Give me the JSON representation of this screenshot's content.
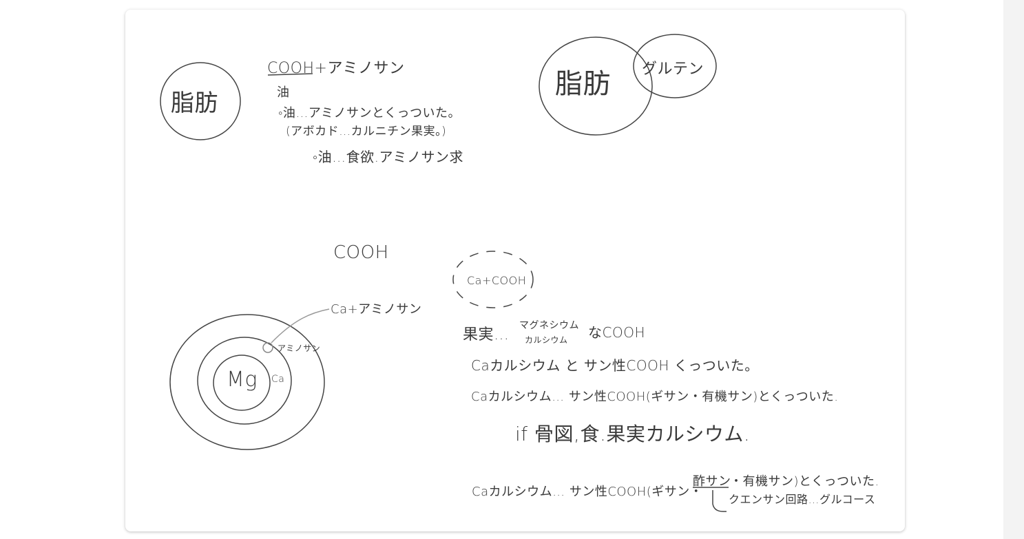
{
  "note": {
    "top_left": {
      "circle_label": "脂肪",
      "formula": "COOH+アミノサン",
      "oil": "油",
      "line1": "◦油…アミノサンとくっついた。",
      "line2": "(アボカド…カルニチン果実。)",
      "line3": "◦油…食欲.アミノサン求"
    },
    "top_right": {
      "big_circle": "脂肪",
      "small_circle": "グルテン"
    },
    "bottom_left": {
      "cooh": "COOH",
      "pointer_label": "Ca+アミノサン",
      "amino": "アミノサン",
      "mg": "Mg",
      "ca": "Ca"
    },
    "bottom_right": {
      "dashed_label": "Ca+COOH",
      "fruit": "果実…",
      "magnesium": "マグネシウム",
      "calcium": "カルシウム",
      "na_cooh": "なCOOH",
      "line1": "Caカルシウム と サン性COOH くっついた。",
      "line2": "Caカルシウム… サン性COOH(ギサン・有機サン)とくっついた.",
      "line3": "if 骨図,食.果実カルシウム.",
      "line4a": "Caカルシウム… サン性COOH(ギサン・",
      "line4b": "酢サン",
      "line4c": "・有機サン)とくっついた.",
      "branch": "クエンサン回路…グルコース"
    }
  },
  "colors": {
    "ink": "#3a3a3a",
    "card": "#ffffff",
    "page": "#ffffff"
  }
}
